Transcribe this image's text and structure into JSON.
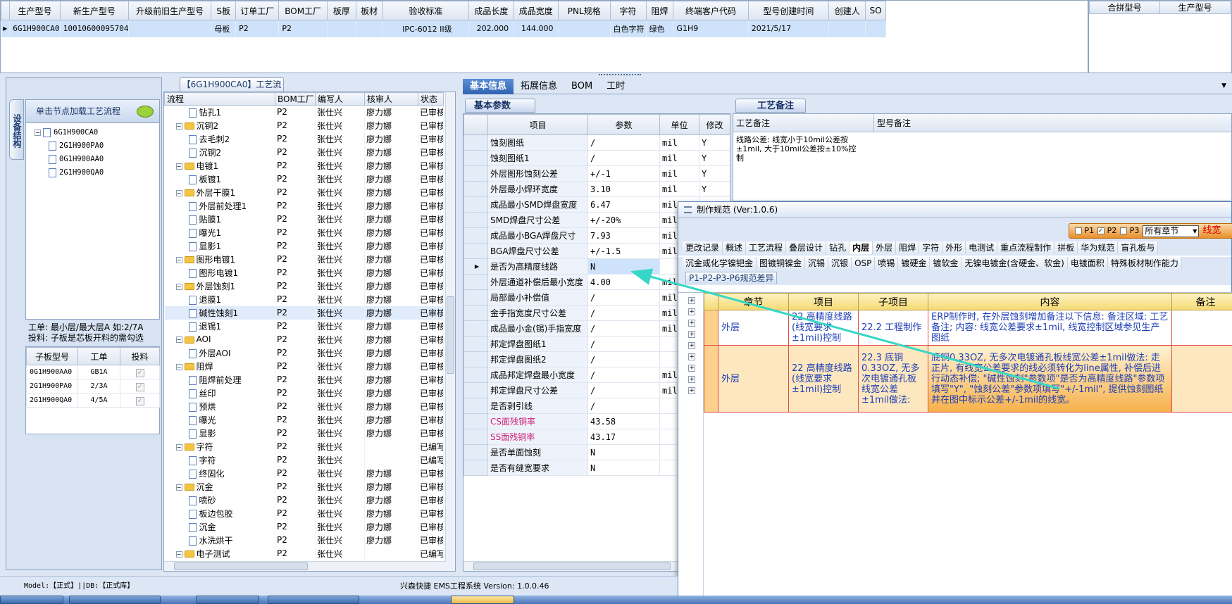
{
  "top_grid": {
    "columns": [
      "生产型号",
      "新生产型号",
      "升级前旧生产型号",
      "S板",
      "订单工厂",
      "BOM工厂",
      "板厚",
      "板材",
      "验收标准",
      "成品长度",
      "成品宽度",
      "PNL规格",
      "字符",
      "阻焊",
      "终端客户代码",
      "型号创建时间",
      "创建人",
      "SO"
    ],
    "row": [
      "6G1H900CA0",
      "10010600095704",
      "",
      "母板",
      "P2",
      "P2",
      "",
      "",
      "IPC-6012 II级",
      "202.000",
      "144.000",
      "",
      "白色字符",
      "绿色",
      "G1H9",
      "2021/5/17",
      "",
      ""
    ]
  },
  "top_right": {
    "columns": [
      "合拼型号",
      "生产型号"
    ]
  },
  "left_panel": {
    "side_tab": "设备结构",
    "header": "单击节点加载工艺流程",
    "root": "6G1H900CA0",
    "children": [
      "2G1H900PA0",
      "0G1H900AA0",
      "2G1H900QA0"
    ],
    "info_line1": "工单: 最小层/最大层A 如:2/7A",
    "info_line2": "投料: 子板是芯板开料的需勾选",
    "sub_grid": {
      "columns": [
        "子板型号",
        "工单",
        "投料"
      ],
      "rows": [
        {
          "model": "0G1H900AA0",
          "order": "GB1A",
          "checked": true
        },
        {
          "model": "2G1H900PA0",
          "order": "2/3A",
          "checked": true
        },
        {
          "model": "2G1H900QA0",
          "order": "4/5A",
          "checked": true
        }
      ]
    }
  },
  "process_panel": {
    "tab": "【6G1H900CA0】工艺流程",
    "columns": [
      "流程",
      "BOM工厂",
      "编写人",
      "核审人",
      "状态"
    ],
    "rows": [
      {
        "name": "钻孔1",
        "kind": "doc",
        "level": 2,
        "bom": "P2",
        "writer": "张仕兴",
        "reviewer": "廖力娜",
        "status": "已审核"
      },
      {
        "name": "沉铜2",
        "kind": "folder",
        "level": 1,
        "bom": "P2",
        "writer": "张仕兴",
        "reviewer": "廖力娜",
        "status": "已审核"
      },
      {
        "name": "去毛刺2",
        "kind": "doc",
        "level": 2,
        "bom": "P2",
        "writer": "张仕兴",
        "reviewer": "廖力娜",
        "status": "已审核"
      },
      {
        "name": "沉铜2",
        "kind": "doc",
        "level": 2,
        "bom": "P2",
        "writer": "张仕兴",
        "reviewer": "廖力娜",
        "status": "已审核"
      },
      {
        "name": "电镀1",
        "kind": "folder",
        "level": 1,
        "bom": "P2",
        "writer": "张仕兴",
        "reviewer": "廖力娜",
        "status": "已审核"
      },
      {
        "name": "板镀1",
        "kind": "doc",
        "level": 2,
        "bom": "P2",
        "writer": "张仕兴",
        "reviewer": "廖力娜",
        "status": "已审核"
      },
      {
        "name": "外层干膜1",
        "kind": "folder",
        "level": 1,
        "bom": "P2",
        "writer": "张仕兴",
        "reviewer": "廖力娜",
        "status": "已审核"
      },
      {
        "name": "外层前处理1",
        "kind": "doc",
        "level": 2,
        "bom": "P2",
        "writer": "张仕兴",
        "reviewer": "廖力娜",
        "status": "已审核"
      },
      {
        "name": "贴膜1",
        "kind": "doc",
        "level": 2,
        "bom": "P2",
        "writer": "张仕兴",
        "reviewer": "廖力娜",
        "status": "已审核"
      },
      {
        "name": "曝光1",
        "kind": "doc",
        "level": 2,
        "bom": "P2",
        "writer": "张仕兴",
        "reviewer": "廖力娜",
        "status": "已审核"
      },
      {
        "name": "显影1",
        "kind": "doc",
        "level": 2,
        "bom": "P2",
        "writer": "张仕兴",
        "reviewer": "廖力娜",
        "status": "已审核"
      },
      {
        "name": "图形电镀1",
        "kind": "folder",
        "level": 1,
        "bom": "P2",
        "writer": "张仕兴",
        "reviewer": "廖力娜",
        "status": "已审核"
      },
      {
        "name": "图形电镀1",
        "kind": "doc",
        "level": 2,
        "bom": "P2",
        "writer": "张仕兴",
        "reviewer": "廖力娜",
        "status": "已审核"
      },
      {
        "name": "外层蚀刻1",
        "kind": "folder",
        "level": 1,
        "bom": "P2",
        "writer": "张仕兴",
        "reviewer": "廖力娜",
        "status": "已审核"
      },
      {
        "name": "退膜1",
        "kind": "doc",
        "level": 2,
        "bom": "P2",
        "writer": "张仕兴",
        "reviewer": "廖力娜",
        "status": "已审核"
      },
      {
        "name": "碱性蚀刻1",
        "kind": "doc",
        "level": 2,
        "bom": "P2",
        "writer": "张仕兴",
        "reviewer": "廖力娜",
        "status": "已审核",
        "selected": true
      },
      {
        "name": "退锡1",
        "kind": "doc",
        "level": 2,
        "bom": "P2",
        "writer": "张仕兴",
        "reviewer": "廖力娜",
        "status": "已审核"
      },
      {
        "name": "AOI",
        "kind": "folder",
        "level": 1,
        "bom": "P2",
        "writer": "张仕兴",
        "reviewer": "廖力娜",
        "status": "已审核"
      },
      {
        "name": "外层AOI",
        "kind": "doc",
        "level": 2,
        "bom": "P2",
        "writer": "张仕兴",
        "reviewer": "廖力娜",
        "status": "已审核"
      },
      {
        "name": "阻焊",
        "kind": "folder",
        "level": 1,
        "bom": "P2",
        "writer": "张仕兴",
        "reviewer": "廖力娜",
        "status": "已审核"
      },
      {
        "name": "阻焊前处理",
        "kind": "doc",
        "level": 2,
        "bom": "P2",
        "writer": "张仕兴",
        "reviewer": "廖力娜",
        "status": "已审核"
      },
      {
        "name": "丝印",
        "kind": "doc",
        "level": 2,
        "bom": "P2",
        "writer": "张仕兴",
        "reviewer": "廖力娜",
        "status": "已审核"
      },
      {
        "name": "预烘",
        "kind": "doc",
        "level": 2,
        "bom": "P2",
        "writer": "张仕兴",
        "reviewer": "廖力娜",
        "status": "已审核"
      },
      {
        "name": "曝光",
        "kind": "doc",
        "level": 2,
        "bom": "P2",
        "writer": "张仕兴",
        "reviewer": "廖力娜",
        "status": "已审核"
      },
      {
        "name": "显影",
        "kind": "doc",
        "level": 2,
        "bom": "P2",
        "writer": "张仕兴",
        "reviewer": "廖力娜",
        "status": "已审核"
      },
      {
        "name": "字符",
        "kind": "folder",
        "level": 1,
        "bom": "P2",
        "writer": "张仕兴",
        "reviewer": "",
        "status": "已编写"
      },
      {
        "name": "字符",
        "kind": "doc",
        "level": 2,
        "bom": "P2",
        "writer": "张仕兴",
        "reviewer": "",
        "status": "已编写"
      },
      {
        "name": "终固化",
        "kind": "doc",
        "level": 2,
        "bom": "P2",
        "writer": "张仕兴",
        "reviewer": "廖力娜",
        "status": "已审核"
      },
      {
        "name": "沉金",
        "kind": "folder",
        "level": 1,
        "bom": "P2",
        "writer": "张仕兴",
        "reviewer": "廖力娜",
        "status": "已审核"
      },
      {
        "name": "喷砂",
        "kind": "doc",
        "level": 2,
        "bom": "P2",
        "writer": "张仕兴",
        "reviewer": "廖力娜",
        "status": "已审核"
      },
      {
        "name": "板边包胶",
        "kind": "doc",
        "level": 2,
        "bom": "P2",
        "writer": "张仕兴",
        "reviewer": "廖力娜",
        "status": "已审核"
      },
      {
        "name": "沉金",
        "kind": "doc",
        "level": 2,
        "bom": "P2",
        "writer": "张仕兴",
        "reviewer": "廖力娜",
        "status": "已审核"
      },
      {
        "name": "水洗烘干",
        "kind": "doc",
        "level": 2,
        "bom": "P2",
        "writer": "张仕兴",
        "reviewer": "廖力娜",
        "status": "已审核"
      },
      {
        "name": "电子测试",
        "kind": "folder",
        "level": 1,
        "bom": "P2",
        "writer": "张仕兴",
        "reviewer": "",
        "status": "已编写"
      }
    ]
  },
  "info_tabs": [
    "基本信息",
    "拓展信息",
    "BOM",
    "工时"
  ],
  "basic_params": {
    "title": "基本参数",
    "columns": [
      "项目",
      "参数",
      "单位",
      "修改"
    ],
    "rows": [
      {
        "item": "蚀刻图纸",
        "value": "/",
        "unit": "mil",
        "mod": "Y"
      },
      {
        "item": "蚀刻图纸1",
        "value": "/",
        "unit": "mil",
        "mod": "Y"
      },
      {
        "item": "外层图形蚀刻公差",
        "value": "+/-1",
        "unit": "mil",
        "mod": "Y"
      },
      {
        "item": "外层最小焊环宽度",
        "value": "3.10",
        "unit": "mil",
        "mod": "Y"
      },
      {
        "item": "成品最小SMD焊盘宽度",
        "value": "6.47",
        "unit": "mil",
        "mod": ""
      },
      {
        "item": "SMD焊盘尺寸公差",
        "value": "+/-20%",
        "unit": "mil",
        "mod": ""
      },
      {
        "item": "成品最小BGA焊盘尺寸",
        "value": "7.93",
        "unit": "mil",
        "mod": ""
      },
      {
        "item": "BGA焊盘尺寸公差",
        "value": "+/-1.5",
        "unit": "mil",
        "mod": ""
      },
      {
        "item": "是否为高精度线路",
        "value": "N",
        "unit": "",
        "mod": "",
        "current": true
      },
      {
        "item": "外层通道补偿后最小宽度",
        "value": "4.00",
        "unit": "mil",
        "mod": ""
      },
      {
        "item": "局部最小补偿值",
        "value": "/",
        "unit": "mil",
        "mod": ""
      },
      {
        "item": "金手指宽度尺寸公差",
        "value": "/",
        "unit": "mil",
        "mod": ""
      },
      {
        "item": "成品最小金(锡)手指宽度",
        "value": "/",
        "unit": "mil",
        "mod": ""
      },
      {
        "item": "邦定焊盘图纸1",
        "value": "/",
        "unit": "",
        "mod": ""
      },
      {
        "item": "邦定焊盘图纸2",
        "value": "/",
        "unit": "",
        "mod": ""
      },
      {
        "item": "成品邦定焊盘最小宽度",
        "value": "/",
        "unit": "mil",
        "mod": ""
      },
      {
        "item": "邦定焊盘尺寸公差",
        "value": "/",
        "unit": "mil",
        "mod": ""
      },
      {
        "item": "是否剥引线",
        "value": "/",
        "unit": "",
        "mod": ""
      },
      {
        "item": "CS面残铜率",
        "value": "43.58",
        "unit": "",
        "mod": "",
        "pink": true
      },
      {
        "item": "SS面残铜率",
        "value": "43.17",
        "unit": "",
        "mod": "",
        "pink": true
      },
      {
        "item": "是否单面蚀刻",
        "value": "N",
        "unit": "",
        "mod": ""
      },
      {
        "item": "是否有缝宽要求",
        "value": "N",
        "unit": "",
        "mod": ""
      }
    ]
  },
  "remarks": {
    "title": "工艺备注",
    "col1": "工艺备注",
    "col2": "型号备注",
    "text": "线路公差: 线宽小于10mil公差按±1mil, 大于10mil公差按±10%控制"
  },
  "spec_window": {
    "title": "制作规范 (Ver:1.0.6)",
    "filters": [
      "P1",
      "P2",
      "P3"
    ],
    "chapter_select": "所有章节",
    "line_width_label": "线宽",
    "tabs_row1": [
      "更改记录",
      "概述",
      "工艺流程",
      "叠层设计",
      "钻孔",
      "内层",
      "外层",
      "阻焊",
      "字符",
      "外形",
      "电测试",
      "重点流程制作",
      "拼板",
      "华为规范",
      "盲孔板与"
    ],
    "active_tab": "内层",
    "tabs_row2": [
      "沉金或化学镍钯金",
      "图镀铜镍金",
      "沉锡",
      "沉银",
      "OSP",
      "喷锡",
      "镀硬金",
      "镀软金",
      "无镍电镀金(含硬金、软金)",
      "电镀面积",
      "特殊板材制作能力"
    ],
    "subtab": "P1-P2-P3-P6规范差异",
    "columns": [
      "章节",
      "项目",
      "子项目",
      "内容",
      "备注"
    ],
    "rows": [
      {
        "chapter": "外层",
        "item": "22 高精度线路(线宽要求±1mil)控制",
        "subitem": "22.2 工程制作",
        "content": "ERP制作时, 在外层蚀刻增加备注以下信息: 备注区域: 工艺备注; 内容: 线宽公差要求±1mil, 线宽控制区域参见生产图纸",
        "note": ""
      },
      {
        "chapter": "外层",
        "item": "22 高精度线路(线宽要求±1mil)控制",
        "subitem": "22.3 底铜0.33OZ, 无多次电镀通孔板线宽公差±1mil做法:",
        "content": "底铜0.33OZ, 无多次电镀通孔板线宽公差±1mil做法: 走正片, 有线宽公差要求的线必须转化为line属性, 补偿后进行动态补偿; \"碱性蚀刻\"参数项\"是否为高精度线路\"参数项填写\"Y\", \"蚀刻公差\"参数项填写\"+/-1mil\", 提供蚀刻图纸并在图中标示公差+/-1mil的线宽。",
        "note": ""
      }
    ]
  },
  "status_bar": {
    "left": "Model:【正式】||DB:【正式库】",
    "center": "兴森快捷 EMS工程系统 Version: 1.0.0.46"
  }
}
